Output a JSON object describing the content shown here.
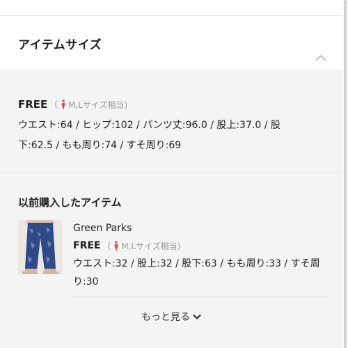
{
  "header": {
    "title": "アイテムサイズ",
    "toggle_icon": "chevron-up-icon"
  },
  "size_chart": {
    "size_name": "FREE",
    "note_open": "(",
    "note_icon": "person-icon",
    "note_text": "M,Lサイズ相当)",
    "measurements": "ウエスト:64 / ヒップ:102 / パンツ丈:96.0 / 股上:37.0 / 股下:62.5 / もも周り:74 / すそ周り:69"
  },
  "previous_purchase": {
    "title": "以前購入したアイテム",
    "item": {
      "brand": "Green Parks",
      "size_name": "FREE",
      "note_open": "(",
      "note_text": "M,Lサイズ相当)",
      "measurements": "ウエスト:32 / 股上:32 / 股下:63 / もも周り:33 / すそ周り:30"
    },
    "more_label": "もっと見る",
    "more_icon": "chevron-down-icon"
  },
  "colors": {
    "accent_icon": "#e0504b",
    "muted_text": "#9a9a9a",
    "background": "#f4f4f4"
  }
}
